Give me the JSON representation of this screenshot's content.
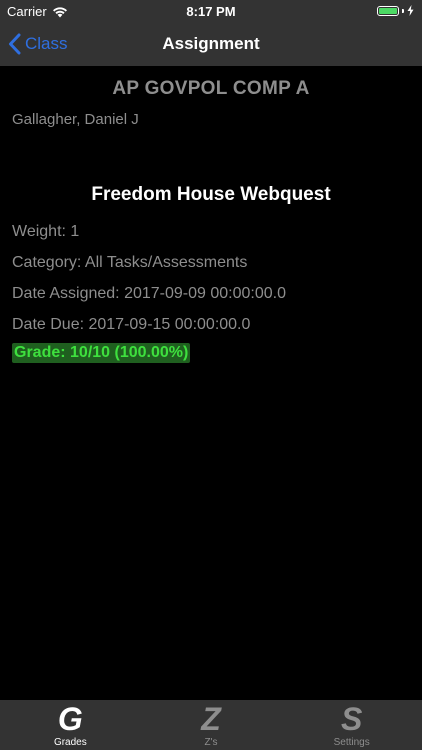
{
  "status_bar": {
    "carrier": "Carrier",
    "time": "8:17 PM",
    "battery_color": "#4cd964"
  },
  "nav": {
    "back_label": "Class",
    "title": "Assignment",
    "accent_color": "#2f6fe0"
  },
  "class_info": {
    "name": "AP GOVPOL COMP A",
    "teacher": "Gallagher, Daniel J"
  },
  "assignment": {
    "title": "Freedom House Webquest",
    "weight": "Weight: 1",
    "category": "Category: All Tasks/Assessments",
    "date_assigned": "Date Assigned: 2017-09-09 00:00:00.0",
    "date_due": "Date Due: 2017-09-15 00:00:00.0",
    "grade": "Grade: 10/10 (100.00%)",
    "grade_color": "#3ee03e"
  },
  "tabs": [
    {
      "glyph": "G",
      "label": "Grades",
      "active": true
    },
    {
      "glyph": "Z",
      "label": "Z's",
      "active": false
    },
    {
      "glyph": "S",
      "label": "Settings",
      "active": false
    }
  ]
}
